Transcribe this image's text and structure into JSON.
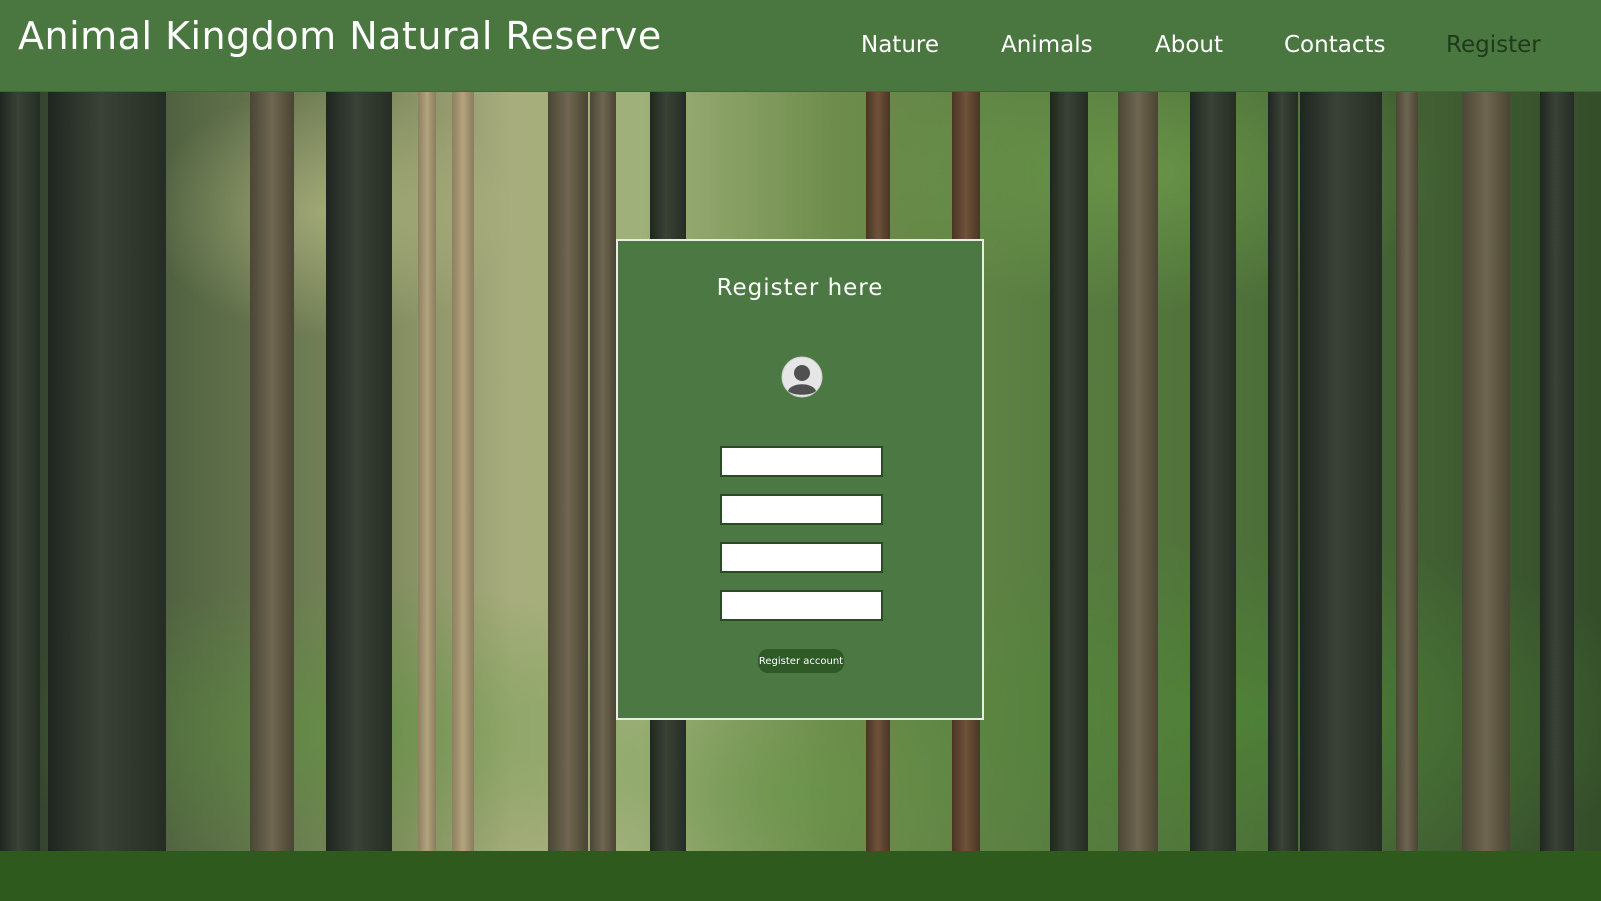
{
  "header": {
    "title": "Animal Kingdom Natural Reserve",
    "nav": [
      {
        "label": "Nature"
      },
      {
        "label": "Animals"
      },
      {
        "label": "About"
      },
      {
        "label": "Contacts"
      },
      {
        "label": "Register",
        "active": true
      }
    ]
  },
  "register_form": {
    "title": "Register here",
    "avatar_icon": "user-avatar-icon",
    "fields": [
      {
        "value": "",
        "placeholder": ""
      },
      {
        "value": "",
        "placeholder": ""
      },
      {
        "value": "",
        "placeholder": ""
      },
      {
        "value": "",
        "placeholder": ""
      }
    ],
    "submit_label": "Register account"
  },
  "colors": {
    "header_bg": "#4a7640",
    "card_bg": "#4b7843",
    "button_bg": "#2f5a28",
    "footer_bg": "#2e5a1d",
    "active_nav": "#1f3a1a"
  }
}
